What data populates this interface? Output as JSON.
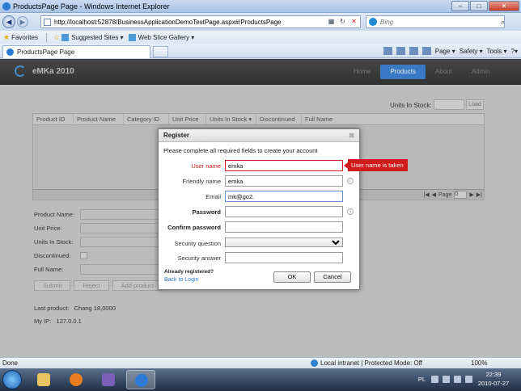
{
  "window": {
    "title": "ProductsPage Page - Windows Internet Explorer"
  },
  "addressbar": {
    "url": "http://localhost:52878/BusinessApplicationDemoTestPage.aspx#/ProductsPage",
    "search_placeholder": "Bing"
  },
  "favorites": {
    "label": "Favorites",
    "items": [
      "Suggested Sites ▾",
      "Web Slice Gallery ▾"
    ]
  },
  "tab": {
    "title": "ProductsPage Page"
  },
  "commandbar": {
    "page": "Page ▾",
    "safety": "Safety ▾",
    "tools": "Tools ▾",
    "help": "?▾"
  },
  "app": {
    "brand": "eMKa 2010",
    "nav": [
      "Home",
      "Products",
      "About",
      "Admin"
    ]
  },
  "grid": {
    "units_in_stock_label": "Units In Stock:",
    "load_label": "Load",
    "columns": [
      "Product ID",
      "Product Name",
      "Category ID",
      "Unit Price",
      "Units In Stock ▾",
      "Discontinued",
      "Full Name"
    ],
    "pager_label": "Page",
    "pager_value": "0"
  },
  "form": {
    "product_name": "Product Name:",
    "unit_price": "Unit Price:",
    "units_in_stock": "Units In Stock:",
    "discontinued": "Discontinued:",
    "full_name": "Full Name:",
    "submit": "Submit",
    "reject": "Reject",
    "add_product": "Add product"
  },
  "footer": {
    "last_product_label": "Last product:",
    "last_product_value": "Chang 18,0000",
    "my_ip_label": "My IP:",
    "my_ip_value": "127.0.0.1"
  },
  "dialog": {
    "title": "Register",
    "intro": "Please complete all required fields to create your account",
    "fields": {
      "user_name": {
        "label": "User name",
        "value": "emka"
      },
      "friendly_name": {
        "label": "Friendly name",
        "value": "emka"
      },
      "email": {
        "label": "Email",
        "value": "mk@go2."
      },
      "password": {
        "label": "Password",
        "value": ""
      },
      "confirm_password": {
        "label": "Confirm password",
        "value": ""
      },
      "security_question": {
        "label": "Security question",
        "value": ""
      },
      "security_answer": {
        "label": "Security answer",
        "value": ""
      }
    },
    "error_tooltip": "User name is taken",
    "already_registered": "Already registered?",
    "back_to_login": "Back to Login",
    "ok": "OK",
    "cancel": "Cancel"
  },
  "statusbar": {
    "status": "Done",
    "zone": "Local intranet | Protected Mode: Off",
    "zoom": "100%"
  },
  "taskbar": {
    "language": "PL",
    "time": "22:39",
    "date": "2010-07-27"
  },
  "colors": {
    "accent": "#2c7ad6",
    "error": "#d11b1b"
  }
}
